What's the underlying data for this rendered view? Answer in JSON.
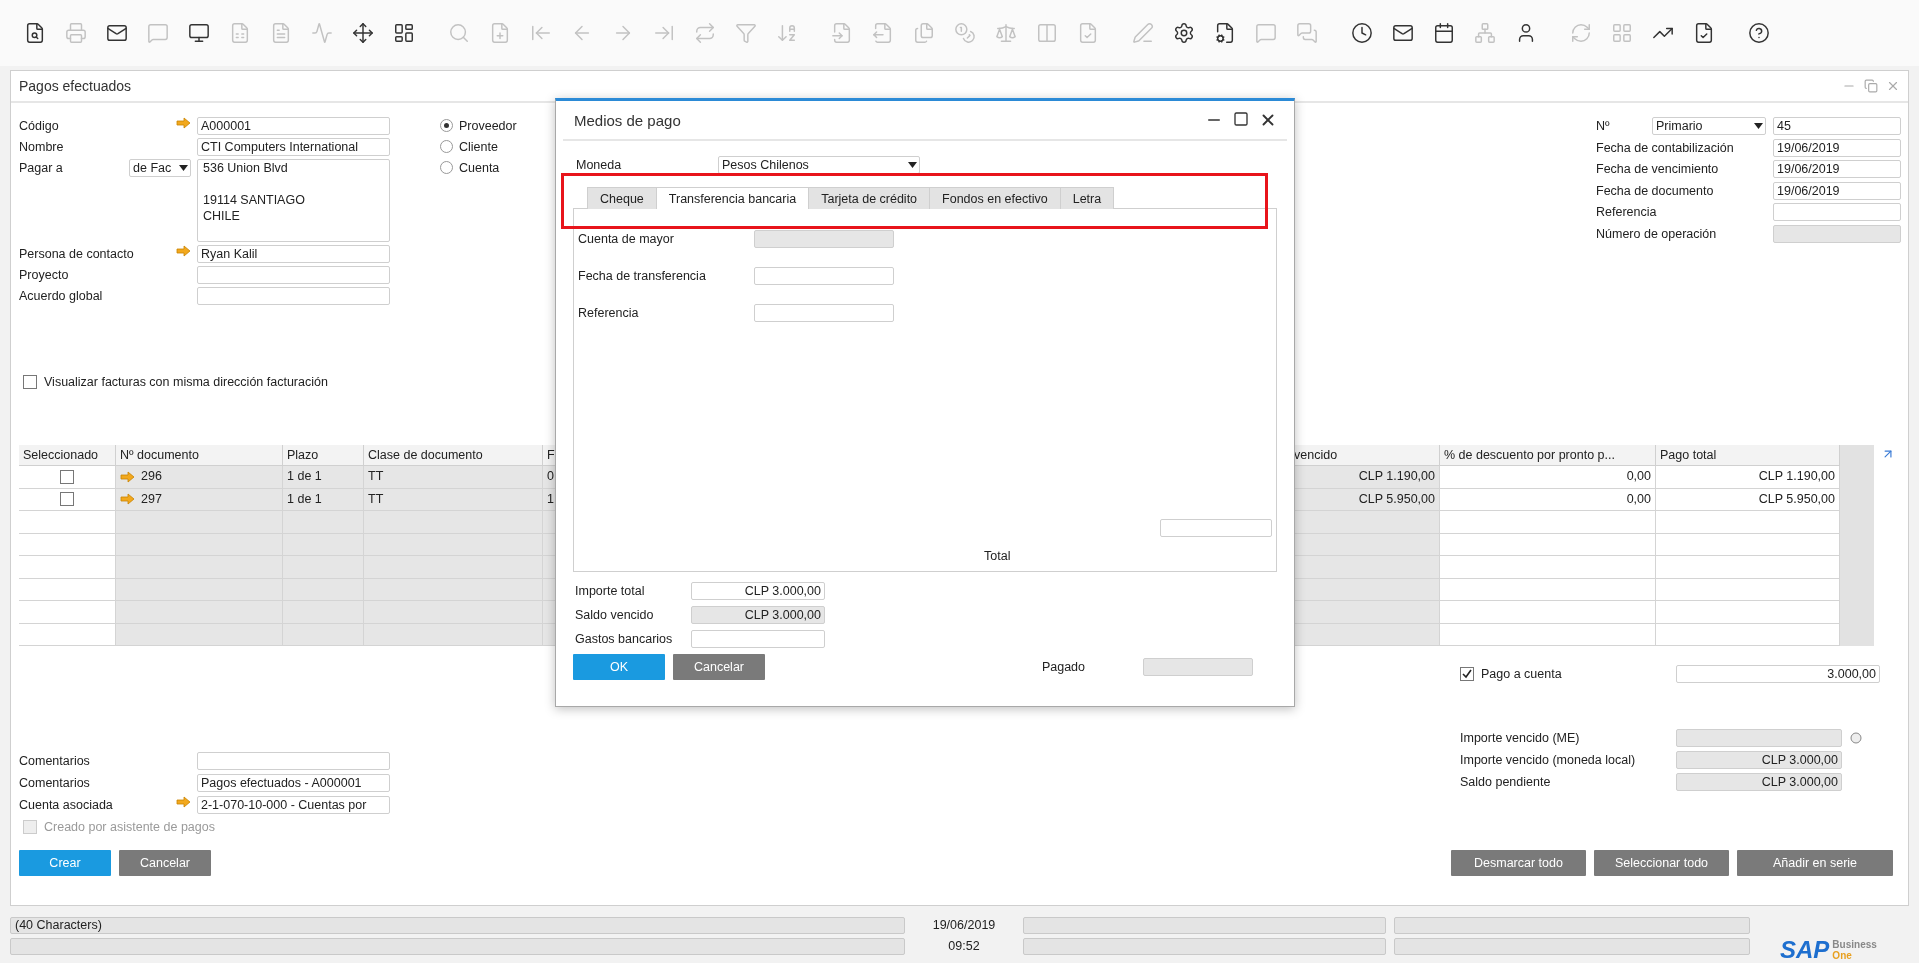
{
  "toolbar": [
    [
      {
        "disabled": false
      },
      {
        "disabled": true
      },
      {
        "disabled": false
      },
      {
        "disabled": true
      },
      {
        "disabled": false
      },
      {
        "disabled": true
      },
      {
        "disabled": true
      },
      {
        "disabled": true
      },
      {
        "disabled": false
      },
      {
        "disabled": false
      }
    ],
    [
      {
        "disabled": true
      },
      {
        "disabled": true
      },
      {
        "disabled": true
      },
      {
        "disabled": true
      },
      {
        "disabled": true
      },
      {
        "disabled": true
      },
      {
        "disabled": true
      },
      {
        "disabled": true
      },
      {
        "disabled": true
      }
    ],
    [
      {
        "disabled": true
      },
      {
        "disabled": true
      },
      {
        "disabled": true
      },
      {
        "disabled": true
      },
      {
        "disabled": true
      },
      {
        "disabled": true
      },
      {
        "disabled": true
      }
    ],
    [
      {
        "disabled": true
      },
      {
        "disabled": false
      },
      {
        "disabled": false
      },
      {
        "disabled": true
      },
      {
        "disabled": true
      }
    ],
    [
      {
        "disabled": false
      },
      {
        "disabled": false
      },
      {
        "disabled": false
      },
      {
        "disabled": true
      },
      {
        "disabled": false
      }
    ],
    [
      {
        "disabled": true
      },
      {
        "disabled": true
      },
      {
        "disabled": false
      },
      {
        "disabled": false
      }
    ],
    [
      {
        "disabled": false
      }
    ]
  ],
  "window": {
    "title": "Pagos efectuados"
  },
  "left_fields": [
    {
      "kind": "field",
      "label": "Código",
      "value": "A000001",
      "link": true
    },
    {
      "kind": "field",
      "label": "Nombre",
      "value": "CTI  Computers International",
      "link": false
    },
    {
      "kind": "address",
      "label": "Pagar a",
      "select": "de Fac",
      "value": "536 Union Blvd\n\n19114 SANTIAGO\nCHILE"
    },
    {
      "kind": "field",
      "label": "Persona de contacto",
      "value": "Ryan Kalil",
      "link": true
    },
    {
      "kind": "field",
      "label": "Proyecto",
      "link": false
    },
    {
      "kind": "field",
      "label": "Acuerdo global",
      "link": false
    }
  ],
  "partner_type": [
    {
      "label": "Proveedor",
      "selected": true
    },
    {
      "label": "Cliente",
      "selected": false
    },
    {
      "label": "Cuenta",
      "selected": false
    }
  ],
  "right_fields": [
    {
      "label": "Nº",
      "select": "Primario",
      "value": "45",
      "readonly": false
    },
    {
      "label": "Fecha de contabilización",
      "value": "19/06/2019",
      "readonly": false
    },
    {
      "label": "Fecha de vencimiento",
      "value": "19/06/2019",
      "readonly": false
    },
    {
      "label": "Fecha de documento",
      "value": "19/06/2019",
      "readonly": false
    },
    {
      "label": "Referencia",
      "readonly": false
    },
    {
      "label": "Número de operación",
      "readonly": true
    }
  ],
  "same_address": {
    "label": "Visualizar facturas con misma dirección facturación",
    "checked": false
  },
  "table": {
    "columns": [
      {
        "label": "Seleccionado",
        "kind": "check",
        "readonly": false
      },
      {
        "label": "Nº documento",
        "kind": "link",
        "readonly": true
      },
      {
        "label": "Plazo",
        "kind": "text",
        "readonly": true
      },
      {
        "label": "Clase de documento",
        "kind": "text",
        "readonly": true
      },
      {
        "label": "F",
        "kind": "text",
        "readonly": true
      },
      {
        "label": "vencido",
        "kind": "amount",
        "readonly": true
      },
      {
        "label": "% de descuento por pronto p...",
        "kind": "amount",
        "readonly": false
      },
      {
        "label": "Pago total",
        "kind": "amount",
        "readonly": false
      }
    ],
    "rows": [
      {
        "cells": [
          {
            "checked": false
          },
          "296",
          "1 de 1",
          "TT",
          "0",
          "CLP 1.190,00",
          "0,00",
          "CLP 1.190,00"
        ]
      },
      {
        "cells": [
          {
            "checked": false
          },
          "297",
          "1 de 1",
          "TT",
          "1",
          "CLP 5.950,00",
          "0,00",
          "CLP 5.950,00"
        ]
      }
    ]
  },
  "payment_on_account": {
    "label": "Pago a cuenta",
    "checked": true,
    "value": "3.000,00"
  },
  "totals": [
    {
      "label": "Importe vencido (ME)"
    },
    {
      "label": "Importe vencido (moneda local)",
      "value": "CLP 3.000,00"
    },
    {
      "label": "Saldo pendiente",
      "value": "CLP 3.000,00"
    }
  ],
  "footer_fields": [
    {
      "label": "Comentarios",
      "link": false
    },
    {
      "label": "Comentarios",
      "value": "Pagos efectuados - A000001",
      "link": false
    },
    {
      "label": "Cuenta asociada",
      "value": "2-1-070-10-000 - Cuentas por",
      "link": true
    }
  ],
  "wizard_checkbox": {
    "label": "Creado por asistente de pagos",
    "checked": false,
    "disabled": true
  },
  "buttons": [
    {
      "label": "Crear",
      "primary": true
    },
    {
      "label": "Cancelar",
      "primary": false
    }
  ],
  "table_buttons": [
    "Desmarcar todo",
    "Seleccionar todo",
    "Añadir en serie"
  ],
  "status_bar": {
    "message": "(40 Characters)",
    "date": "19/06/2019",
    "time": "09:52"
  },
  "logo": {
    "brand": "SAP",
    "line1": "Business",
    "line2": "One"
  },
  "dialog": {
    "title": "Medios de pago",
    "currency": {
      "label": "Moneda",
      "value": "Pesos Chilenos"
    },
    "tabs": [
      {
        "label": "Cheque",
        "selected": false
      },
      {
        "label": "Transferencia bancaria",
        "selected": true
      },
      {
        "label": "Tarjeta de crédito",
        "selected": false
      },
      {
        "label": "Fondos en efectivo",
        "selected": false
      },
      {
        "label": "Letra",
        "selected": false
      }
    ],
    "fields": [
      {
        "label": "Cuenta de mayor",
        "readonly": true
      },
      {
        "label": "Fecha de transferencia",
        "readonly": false
      },
      {
        "label": "Referencia",
        "readonly": false
      }
    ],
    "total_label": "Total",
    "amounts": [
      {
        "label": "Importe total",
        "value": "CLP 3.000,00",
        "readonly": false
      },
      {
        "label": "Saldo vencido",
        "value": "CLP 3.000,00",
        "readonly": true
      },
      {
        "label": "Gastos bancarios",
        "readonly": false
      }
    ],
    "buttons": [
      {
        "label": "OK",
        "primary": true
      },
      {
        "label": "Cancelar",
        "primary": false
      }
    ],
    "paid_label": "Pagado"
  }
}
